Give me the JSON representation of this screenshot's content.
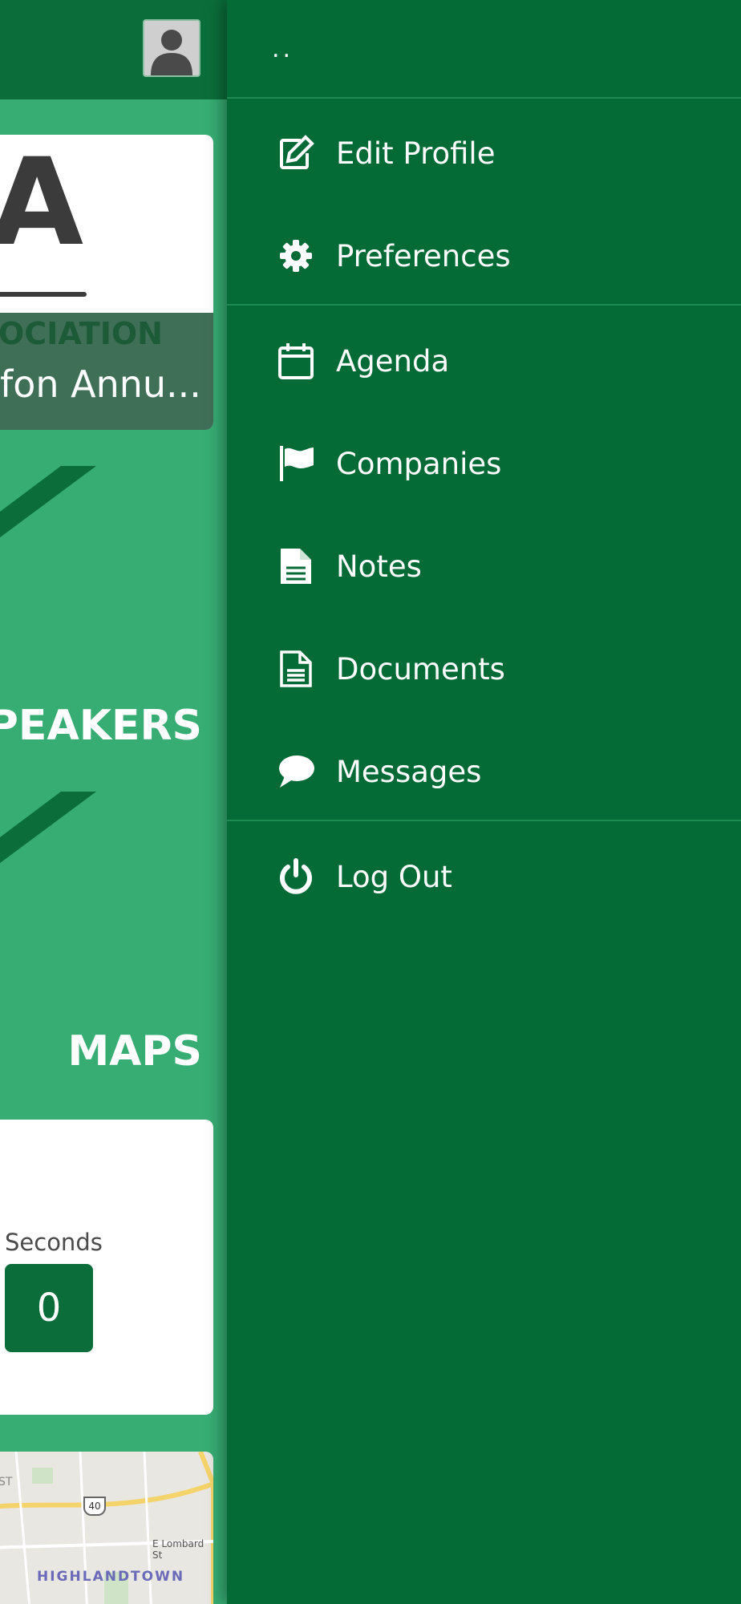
{
  "drawer": {
    "username": "..",
    "items": [
      {
        "label": "Edit Profile",
        "icon": "edit-icon"
      },
      {
        "label": "Preferences",
        "icon": "gear-icon"
      },
      {
        "label": "Agenda",
        "icon": "calendar-icon"
      },
      {
        "label": "Companies",
        "icon": "flag-icon"
      },
      {
        "label": "Notes",
        "icon": "note-icon"
      },
      {
        "label": "Documents",
        "icon": "document-icon"
      },
      {
        "label": "Messages",
        "icon": "chat-icon"
      },
      {
        "label": "Log Out",
        "icon": "power-icon"
      }
    ]
  },
  "background": {
    "event_logo_letter": "A",
    "event_assoc": "OCIATION",
    "event_title": "fon Annu...",
    "speakers_label": "SPEAKERS",
    "maps_label": "MAPS",
    "countdown_seconds_label": "Seconds",
    "countdown_seconds_value": "0",
    "map_neighborhood": "HIGHLANDTOWN",
    "map_street": "E Lombard St",
    "map_street_partial": "ST",
    "map_route": "40"
  },
  "colors": {
    "drawer_bg": "#046b37",
    "topbar_bg": "#0b6e3a",
    "tile_bg": "#37ad73",
    "divider": "#1f8a52"
  }
}
